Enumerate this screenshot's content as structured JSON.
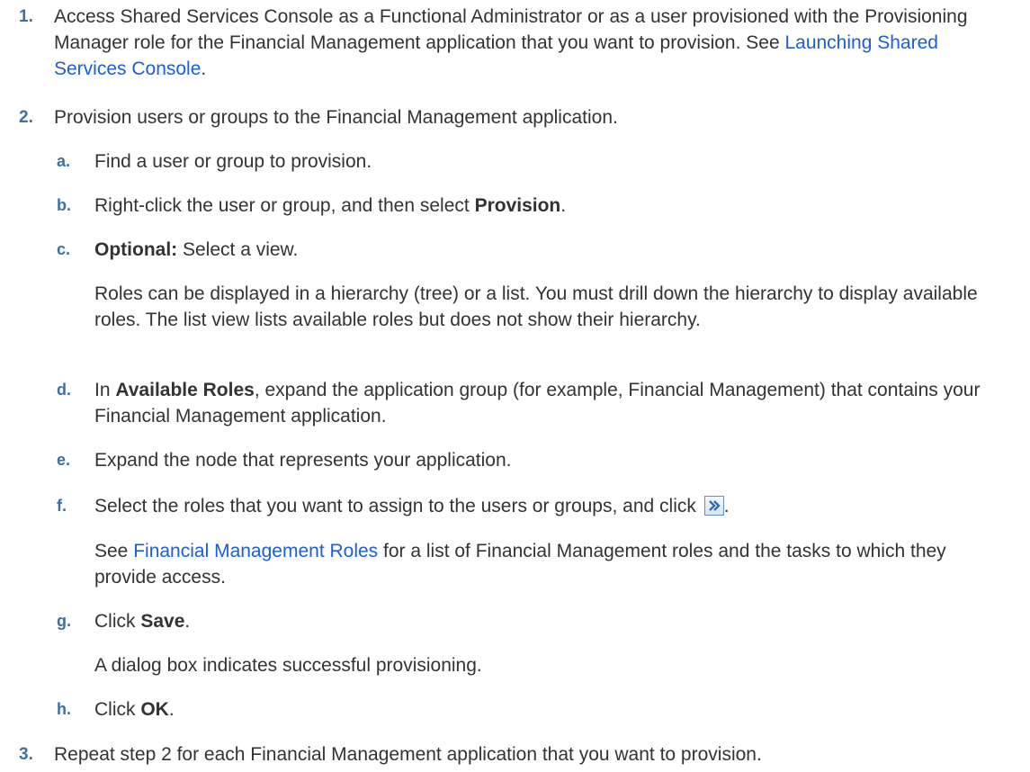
{
  "steps": [
    {
      "number": "1.",
      "text_before": "Access Shared Services Console as a Functional Administrator or as a user provisioned with the Provisioning Manager role for the Financial Management application that you want to provision. See ",
      "link": "Launching Shared Services Console",
      "text_after": "."
    },
    {
      "number": "2.",
      "text": "Provision users or groups to the Financial Management application.",
      "substeps": [
        {
          "letter": "a.",
          "text": "Find a user or group to provision."
        },
        {
          "letter": "b.",
          "text_before": "Right-click the user or group, and then select ",
          "bold": "Provision",
          "text_after": "."
        },
        {
          "letter": "c.",
          "bold": "Optional:",
          "text_after": " Select a view.",
          "note": "Roles can be displayed in a hierarchy (tree) or a list. You must drill down the hierarchy to display available roles. The list view lists available roles but does not show their hierarchy."
        },
        {
          "letter": "d.",
          "text_before": "In ",
          "bold": "Available Roles",
          "text_after": ", expand the application group (for example, Financial Management) that contains your Financial Management application."
        },
        {
          "letter": "e.",
          "text": "Expand the node that represents your application."
        },
        {
          "letter": "f.",
          "text_before": "Select the roles that you want to assign to the users or groups, and click ",
          "icon": "move-right-arrow-icon",
          "text_after": ".",
          "note_link": "Financial Management Roles",
          "note_after": " for a list of Financial Management roles and the tasks to which they provide access.",
          "note_before": "See "
        },
        {
          "letter": "g.",
          "text_before": "Click ",
          "bold": "Save",
          "text_after": ".",
          "note": "A dialog box indicates successful provisioning."
        },
        {
          "letter": "h.",
          "text_before": "Click ",
          "bold": "OK",
          "text_after": "."
        }
      ]
    },
    {
      "number": "3.",
      "text": "Repeat step 2 for each Financial Management application that you want to provision."
    }
  ],
  "colors": {
    "body_text": "#333333",
    "step_number": "#3d6fa3",
    "link": "#1a5fd6"
  }
}
